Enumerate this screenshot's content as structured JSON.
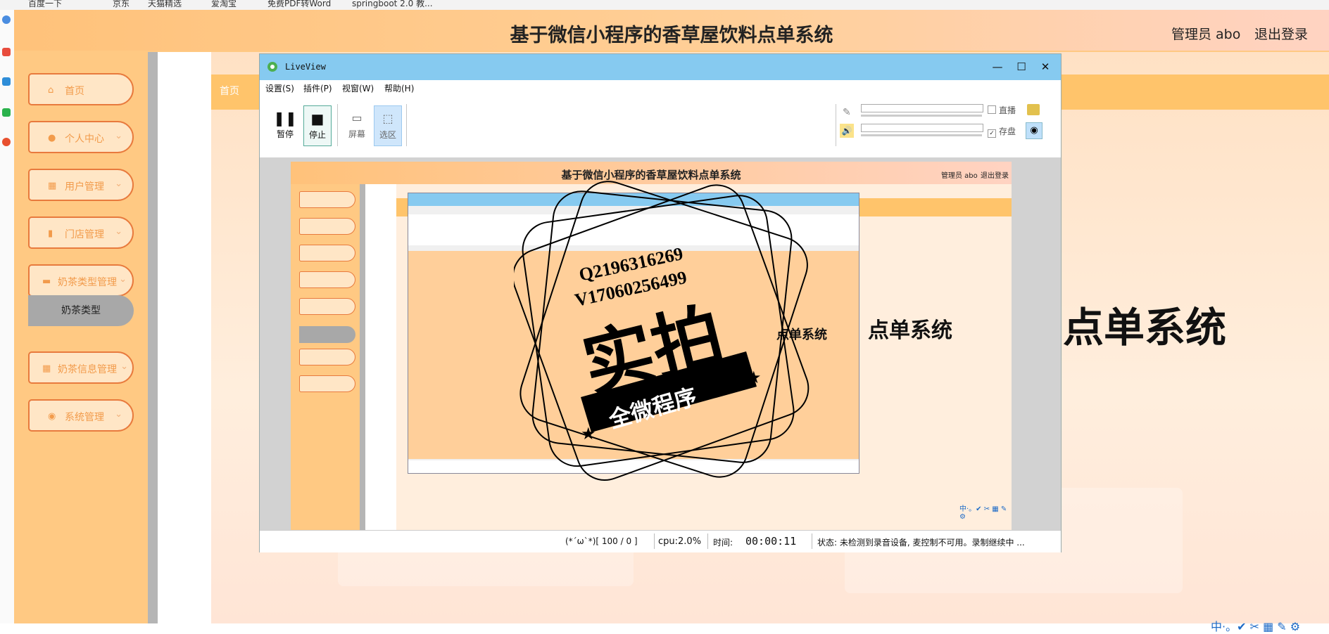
{
  "browser": {
    "bookmarks": [
      "百度一下",
      "京东",
      "天猫精选",
      "爱淘宝",
      "免费PDF转Word",
      "springboot 2.0 教..."
    ]
  },
  "site": {
    "title": "基于微信小程序的香草屋饮料点单系统",
    "admin": "管理员 abo",
    "logout": "退出登录",
    "breadcrumb": "首页",
    "big_text": "点单系统"
  },
  "sidebar": {
    "items": [
      {
        "label": "首页",
        "icon": "home-icon",
        "glyph": "⌂",
        "chevron": ""
      },
      {
        "label": "个人中心",
        "icon": "user-icon",
        "glyph": "●",
        "chevron": "⌄"
      },
      {
        "label": "用户管理",
        "icon": "grid-icon",
        "glyph": "▦",
        "chevron": "⌄"
      },
      {
        "label": "门店管理",
        "icon": "clipboard-icon",
        "glyph": "▮",
        "chevron": "⌄"
      },
      {
        "label": "奶茶类型管理",
        "icon": "cup-icon",
        "glyph": "▬",
        "chevron": "⌄"
      },
      {
        "label": "奶茶信息管理",
        "icon": "grid-icon",
        "glyph": "▦",
        "chevron": "⌄"
      },
      {
        "label": "系统管理",
        "icon": "location-icon",
        "glyph": "◉",
        "chevron": "⌄"
      }
    ],
    "active_subitem": "奶茶类型"
  },
  "liveview": {
    "title": "LiveView",
    "menus": [
      "设置(S)",
      "插件(P)",
      "视窗(W)",
      "帮助(H)"
    ],
    "tools": {
      "pause": "暂停",
      "stop": "停止",
      "screen": "屏幕",
      "region": "选区"
    },
    "checkboxes": {
      "live": "直播",
      "save": "存盘"
    },
    "status": {
      "emoticon": "(*ˊωˋ*)[ 100 / 0 ]",
      "cpu": "cpu:2.0%",
      "time_label": "时间:",
      "time_value": "00:00:11",
      "state": "状态:  未检测到录音设备, 麦控制不可用。录制继续中 ..."
    }
  },
  "preview": {
    "title": "基于微信小程序的香草屋饮料点单系统",
    "admin": "管理员 abo",
    "logout": "退出登录",
    "big_text": "点单系统",
    "big_text_small": "点单系统"
  },
  "watermark": {
    "line1": "Q2196316269",
    "line2": "V17060256499",
    "main": "实拍",
    "banner": "全微程序"
  },
  "tray": {
    "text": "中·。✔ ✂ ▦ ✎ ⚙"
  },
  "colors": {
    "accent_orange": "#ffc983",
    "nav_border": "#e87a3d",
    "liveview_titlebar": "#86caf0",
    "breadcrumb_band": "#ffc46b"
  }
}
